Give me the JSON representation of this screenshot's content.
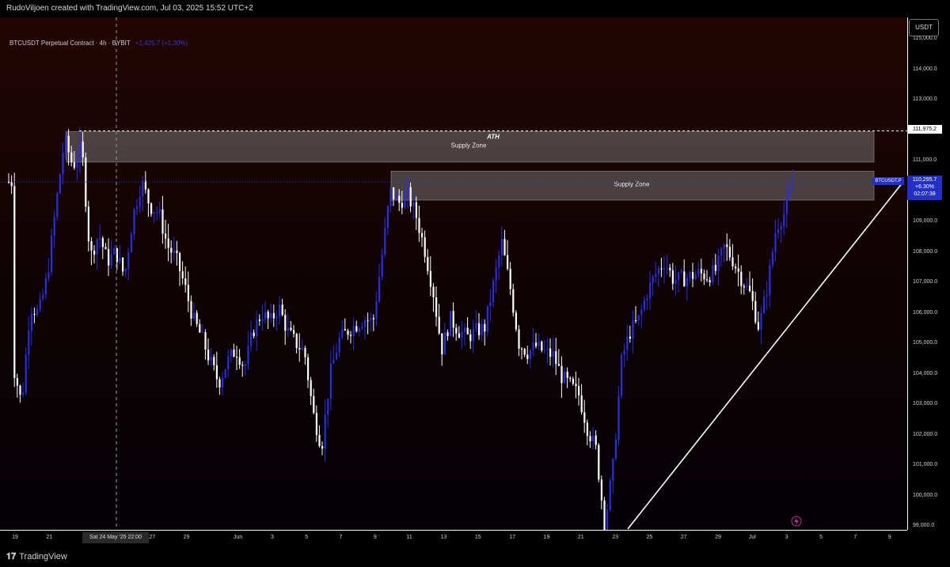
{
  "header": {
    "attribution": "RudoViljoen created with TradingView.com, Jul 03, 2025 15:52 UTC+2"
  },
  "legend": {
    "symbol": "BTCUSDT Perpetual Contract · 4h · BYBIT",
    "change": "+1,425.7 (+1.30%)"
  },
  "price_axis": {
    "currency": "USDT",
    "ticks": [
      "115,000.0",
      "114,000.0",
      "113,000.0",
      "112,000.0",
      "111,000.0",
      "110,000.0",
      "109,000.0",
      "108,000.0",
      "107,000.0",
      "106,000.0",
      "105,000.0",
      "104,000.0",
      "103,000.0",
      "102,000.0",
      "101,000.0",
      "100,000.0",
      "99,000.0"
    ],
    "ath_label": "111,975.2",
    "current_price": "110,295.7",
    "current_change": "+6.30%",
    "countdown": "02:07:38",
    "symbol_tag": "BTCUSDT.P"
  },
  "time_axis": {
    "ticks": [
      "19",
      "21",
      "27",
      "29",
      "Jun",
      "3",
      "5",
      "7",
      "9",
      "11",
      "13",
      "15",
      "17",
      "19",
      "21",
      "23",
      "25",
      "27",
      "29",
      "Jul",
      "3",
      "5",
      "7",
      "9"
    ],
    "crosshair_date": "Sat 24 May '25   22:00"
  },
  "annotations": {
    "ath": "ATH",
    "supply_zone_1": "Supply Zone",
    "supply_zone_2": "Supply Zone"
  },
  "footer": {
    "brand": "TradingView"
  },
  "colors": {
    "up_candle": "#2a2ee0",
    "down_candle": "#ffffff",
    "zone_fill": "#8a8a8a",
    "trendline": "#ffffff"
  },
  "chart_data": {
    "type": "candlestick",
    "timeframe": "4h",
    "ylim": [
      98700,
      115700
    ],
    "ath": 111975.2,
    "last_price": 110295.7,
    "zones": [
      {
        "name": "Supply Zone",
        "from": "2025-05-21",
        "to": "2025-07-08",
        "low": 110950,
        "high": 111950
      },
      {
        "name": "Supply Zone",
        "from": "2025-06-09",
        "to": "2025-07-08",
        "low": 109700,
        "high": 110650
      }
    ],
    "trendline": [
      {
        "date": "2025-06-23",
        "price": 98900
      },
      {
        "date": "2025-07-03",
        "price": 110200
      }
    ],
    "path": [
      {
        "date": "2025-05-19",
        "price": 104300
      },
      {
        "date": "2025-05-19T12",
        "price": 103000
      },
      {
        "date": "2025-05-20",
        "price": 106200
      },
      {
        "date": "2025-05-20T12",
        "price": 106000
      },
      {
        "date": "2025-05-21",
        "price": 107200
      },
      {
        "date": "2025-05-21T12",
        "price": 109500
      },
      {
        "date": "2025-05-22",
        "price": 111700
      },
      {
        "date": "2025-05-22T12",
        "price": 110800
      },
      {
        "date": "2025-05-23",
        "price": 111500
      },
      {
        "date": "2025-05-23T12",
        "price": 107800
      },
      {
        "date": "2025-05-24",
        "price": 108600
      },
      {
        "date": "2025-05-24T12",
        "price": 107700
      },
      {
        "date": "2025-05-25",
        "price": 108000
      },
      {
        "date": "2025-05-25T12",
        "price": 107200
      },
      {
        "date": "2025-05-26",
        "price": 109200
      },
      {
        "date": "2025-05-26T12",
        "price": 110300
      },
      {
        "date": "2025-05-27",
        "price": 109500
      },
      {
        "date": "2025-05-27T12",
        "price": 109300
      },
      {
        "date": "2025-05-28",
        "price": 108200
      },
      {
        "date": "2025-05-28T12",
        "price": 107800
      },
      {
        "date": "2025-05-29",
        "price": 106900
      },
      {
        "date": "2025-05-29T12",
        "price": 105800
      },
      {
        "date": "2025-05-30",
        "price": 105200
      },
      {
        "date": "2025-05-30T12",
        "price": 104400
      },
      {
        "date": "2025-05-31",
        "price": 103700
      },
      {
        "date": "2025-05-31T12",
        "price": 104400
      },
      {
        "date": "2025-06-01",
        "price": 104800
      },
      {
        "date": "2025-06-01T12",
        "price": 104200
      },
      {
        "date": "2025-06-02",
        "price": 105400
      },
      {
        "date": "2025-06-02T12",
        "price": 106000
      },
      {
        "date": "2025-06-03",
        "price": 105700
      },
      {
        "date": "2025-06-03T12",
        "price": 106200
      },
      {
        "date": "2025-06-04",
        "price": 105400
      },
      {
        "date": "2025-06-04T12",
        "price": 105000
      },
      {
        "date": "2025-06-05",
        "price": 104700
      },
      {
        "date": "2025-06-05T12",
        "price": 102700
      },
      {
        "date": "2025-06-06",
        "price": 101600
      },
      {
        "date": "2025-06-06T12",
        "price": 104000
      },
      {
        "date": "2025-06-07",
        "price": 105100
      },
      {
        "date": "2025-06-07T12",
        "price": 105400
      },
      {
        "date": "2025-06-08",
        "price": 105600
      },
      {
        "date": "2025-06-08T12",
        "price": 105800
      },
      {
        "date": "2025-06-09",
        "price": 105700
      },
      {
        "date": "2025-06-09T12",
        "price": 107800
      },
      {
        "date": "2025-06-10",
        "price": 110000
      },
      {
        "date": "2025-06-10T12",
        "price": 109600
      },
      {
        "date": "2025-06-11",
        "price": 109900
      },
      {
        "date": "2025-06-11T12",
        "price": 109200
      },
      {
        "date": "2025-06-12",
        "price": 108100
      },
      {
        "date": "2025-06-12T12",
        "price": 106700
      },
      {
        "date": "2025-06-13",
        "price": 104800
      },
      {
        "date": "2025-06-13T12",
        "price": 105800
      },
      {
        "date": "2025-06-14",
        "price": 105400
      },
      {
        "date": "2025-06-14T12",
        "price": 105200
      },
      {
        "date": "2025-06-15",
        "price": 105400
      },
      {
        "date": "2025-06-15T12",
        "price": 105500
      },
      {
        "date": "2025-06-16",
        "price": 106900
      },
      {
        "date": "2025-06-16T12",
        "price": 108300
      },
      {
        "date": "2025-06-17",
        "price": 106800
      },
      {
        "date": "2025-06-17T12",
        "price": 105000
      },
      {
        "date": "2025-06-18",
        "price": 104700
      },
      {
        "date": "2025-06-18T12",
        "price": 104900
      },
      {
        "date": "2025-06-19",
        "price": 104700
      },
      {
        "date": "2025-06-19T12",
        "price": 104600
      },
      {
        "date": "2025-06-20",
        "price": 103900
      },
      {
        "date": "2025-06-20T12",
        "price": 103600
      },
      {
        "date": "2025-06-21",
        "price": 103300
      },
      {
        "date": "2025-06-21T12",
        "price": 102200
      },
      {
        "date": "2025-06-22",
        "price": 101500
      },
      {
        "date": "2025-06-22T12",
        "price": 99000
      },
      {
        "date": "2025-06-23",
        "price": 101000
      },
      {
        "date": "2025-06-23T12",
        "price": 104500
      },
      {
        "date": "2025-06-24",
        "price": 105400
      },
      {
        "date": "2025-06-24T12",
        "price": 105800
      },
      {
        "date": "2025-06-25",
        "price": 106700
      },
      {
        "date": "2025-06-25T12",
        "price": 107300
      },
      {
        "date": "2025-06-26",
        "price": 107700
      },
      {
        "date": "2025-06-26T12",
        "price": 107100
      },
      {
        "date": "2025-06-27",
        "price": 107100
      },
      {
        "date": "2025-06-27T12",
        "price": 107200
      },
      {
        "date": "2025-06-28",
        "price": 107300
      },
      {
        "date": "2025-06-28T12",
        "price": 107200
      },
      {
        "date": "2025-06-29",
        "price": 107400
      },
      {
        "date": "2025-06-29T12",
        "price": 108200
      },
      {
        "date": "2025-06-30",
        "price": 107700
      },
      {
        "date": "2025-06-30T12",
        "price": 107100
      },
      {
        "date": "2025-07-01",
        "price": 106600
      },
      {
        "date": "2025-07-01T12",
        "price": 105500
      },
      {
        "date": "2025-07-02",
        "price": 106900
      },
      {
        "date": "2025-07-02T12",
        "price": 108800
      },
      {
        "date": "2025-07-03",
        "price": 109300
      },
      {
        "date": "2025-07-03T12",
        "price": 110300
      }
    ]
  }
}
